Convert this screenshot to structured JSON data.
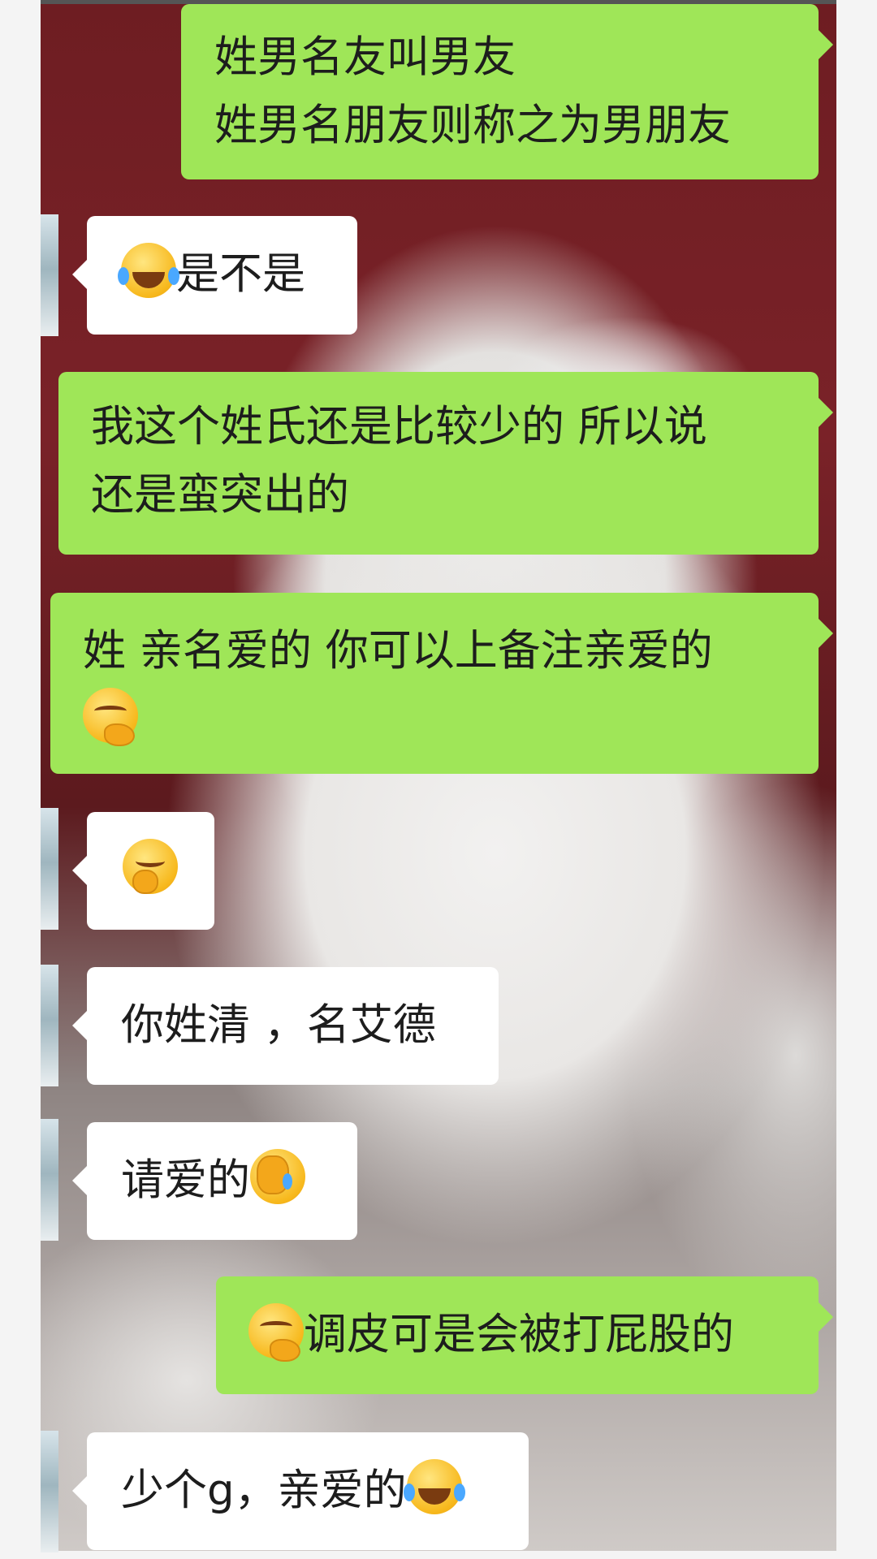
{
  "messages": [
    {
      "from": "me",
      "lines": [
        "姓男名友叫男友",
        "姓男名朋友则称之为男朋友"
      ]
    },
    {
      "from": "other",
      "emoji_lead": "face-with-tears-of-joy",
      "text": "是不是"
    },
    {
      "from": "me",
      "lines": [
        "我这个姓氏还是比较少的  所以说",
        "还是蛮突出的"
      ]
    },
    {
      "from": "me",
      "lines": [
        "姓  亲名爱的  你可以上备注亲爱的"
      ],
      "emoji_line": "smirking-hand-face"
    },
    {
      "from": "other",
      "emoji_only": "hand-over-mouth-face"
    },
    {
      "from": "other",
      "text": "你姓清 ，名艾德"
    },
    {
      "from": "other",
      "text": "请爱的",
      "emoji_trail": "facepalm-tears-face"
    },
    {
      "from": "me",
      "emoji_lead": "smirking-hand-face",
      "text": "调皮可是会被打屁股的"
    },
    {
      "from": "other",
      "text": "少个g，亲爱的",
      "emoji_trail": "face-with-tears-of-joy"
    }
  ],
  "colors": {
    "sent_bubble": "#9fe658",
    "received_bubble": "#ffffff",
    "wallpaper_top": "#7a2228"
  }
}
